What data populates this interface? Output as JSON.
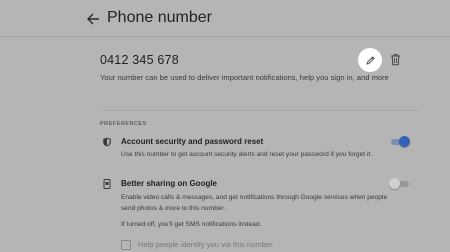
{
  "header": {
    "title": "Phone number",
    "back_icon": "arrow-left-icon"
  },
  "phone": {
    "number": "0412 345 678",
    "description": "Your number can be used to deliver important notifications, help you sign in, and more",
    "edit_icon": "pencil-icon",
    "delete_icon": "trash-icon"
  },
  "preferences": {
    "heading": "PREFERENCES",
    "items": [
      {
        "title": "Account security and password reset",
        "description": "Use this number to get account security alerts and reset your password if you forget it.",
        "icon": "shield-icon",
        "enabled": true
      },
      {
        "title": "Better sharing on Google",
        "description": "Enable video calls & messages, and get notifications through Google services when people send photos & more to this number.",
        "icon": "phone-share-icon",
        "enabled": false,
        "note": "If turned off, you'll get SMS notifications instead.",
        "checkbox_label": "Help people identify you via this number",
        "checkbox_checked": false
      }
    ]
  },
  "colors": {
    "accent": "#3362b7",
    "overlay_background": "#b5b5b5",
    "edit_highlight": "#ffffff"
  }
}
